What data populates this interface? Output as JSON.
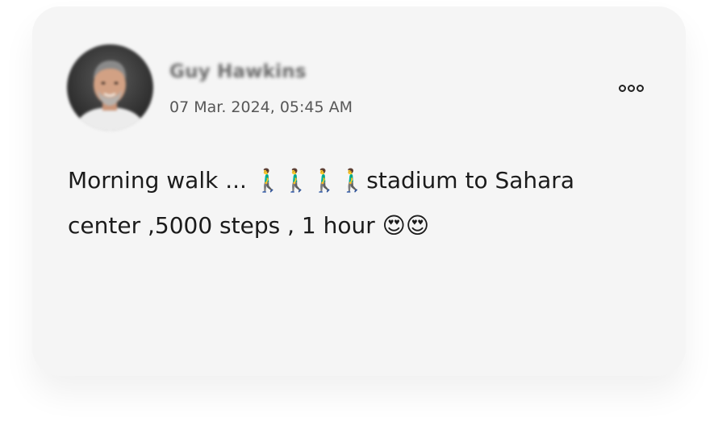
{
  "post": {
    "author_name": "Guy Hawkins",
    "timestamp": "07 Mar. 2024, 05:45 AM",
    "text": "Morning walk ... 🚶‍♂️🚶‍♂️🚶‍♂️🚶‍♂️stadium to Sahara center ,5000 steps , 1 hour 😍😍"
  },
  "icons": {
    "more": "more-horizontal-icon",
    "avatar": "user-avatar"
  },
  "colors": {
    "card_background": "#f5f5f5",
    "text": "#1b1b1b",
    "muted_text": "#575757"
  }
}
